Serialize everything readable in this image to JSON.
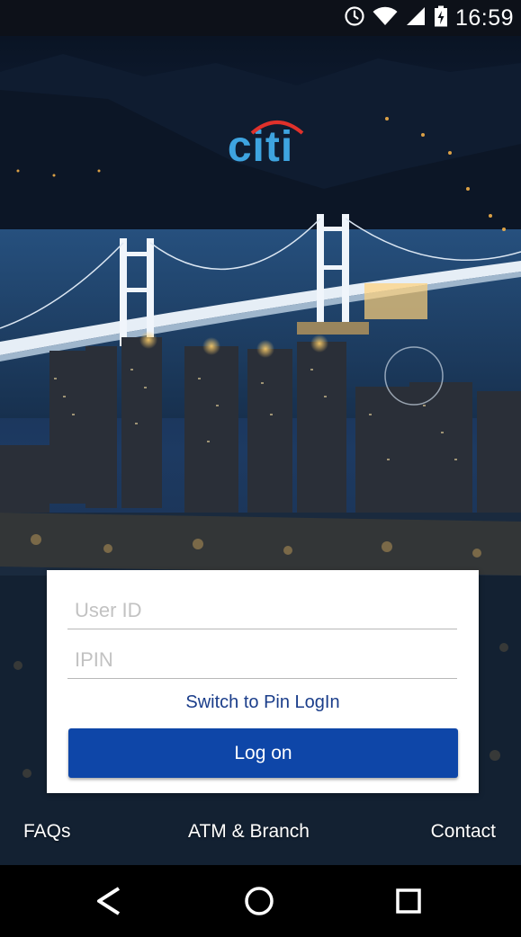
{
  "status_bar": {
    "time": "16:59",
    "icons": [
      "alarm-icon",
      "wifi-icon",
      "signal-icon",
      "battery-charging-icon"
    ]
  },
  "brand": {
    "logo_text": "citi",
    "logo_color": "#3ea4e0",
    "arc_color": "#e0312b"
  },
  "login": {
    "user_id_placeholder": "User ID",
    "user_id_value": "",
    "ipin_placeholder": "IPIN",
    "ipin_value": "",
    "switch_label": "Switch to Pin LogIn",
    "logon_label": "Log on",
    "button_color": "#0e46a8"
  },
  "footer_links": {
    "faqs": "FAQs",
    "atm_branch": "ATM & Branch",
    "contact": "Contact"
  },
  "nav_bar": {
    "icons": [
      "back-icon",
      "home-icon",
      "recents-icon"
    ]
  }
}
